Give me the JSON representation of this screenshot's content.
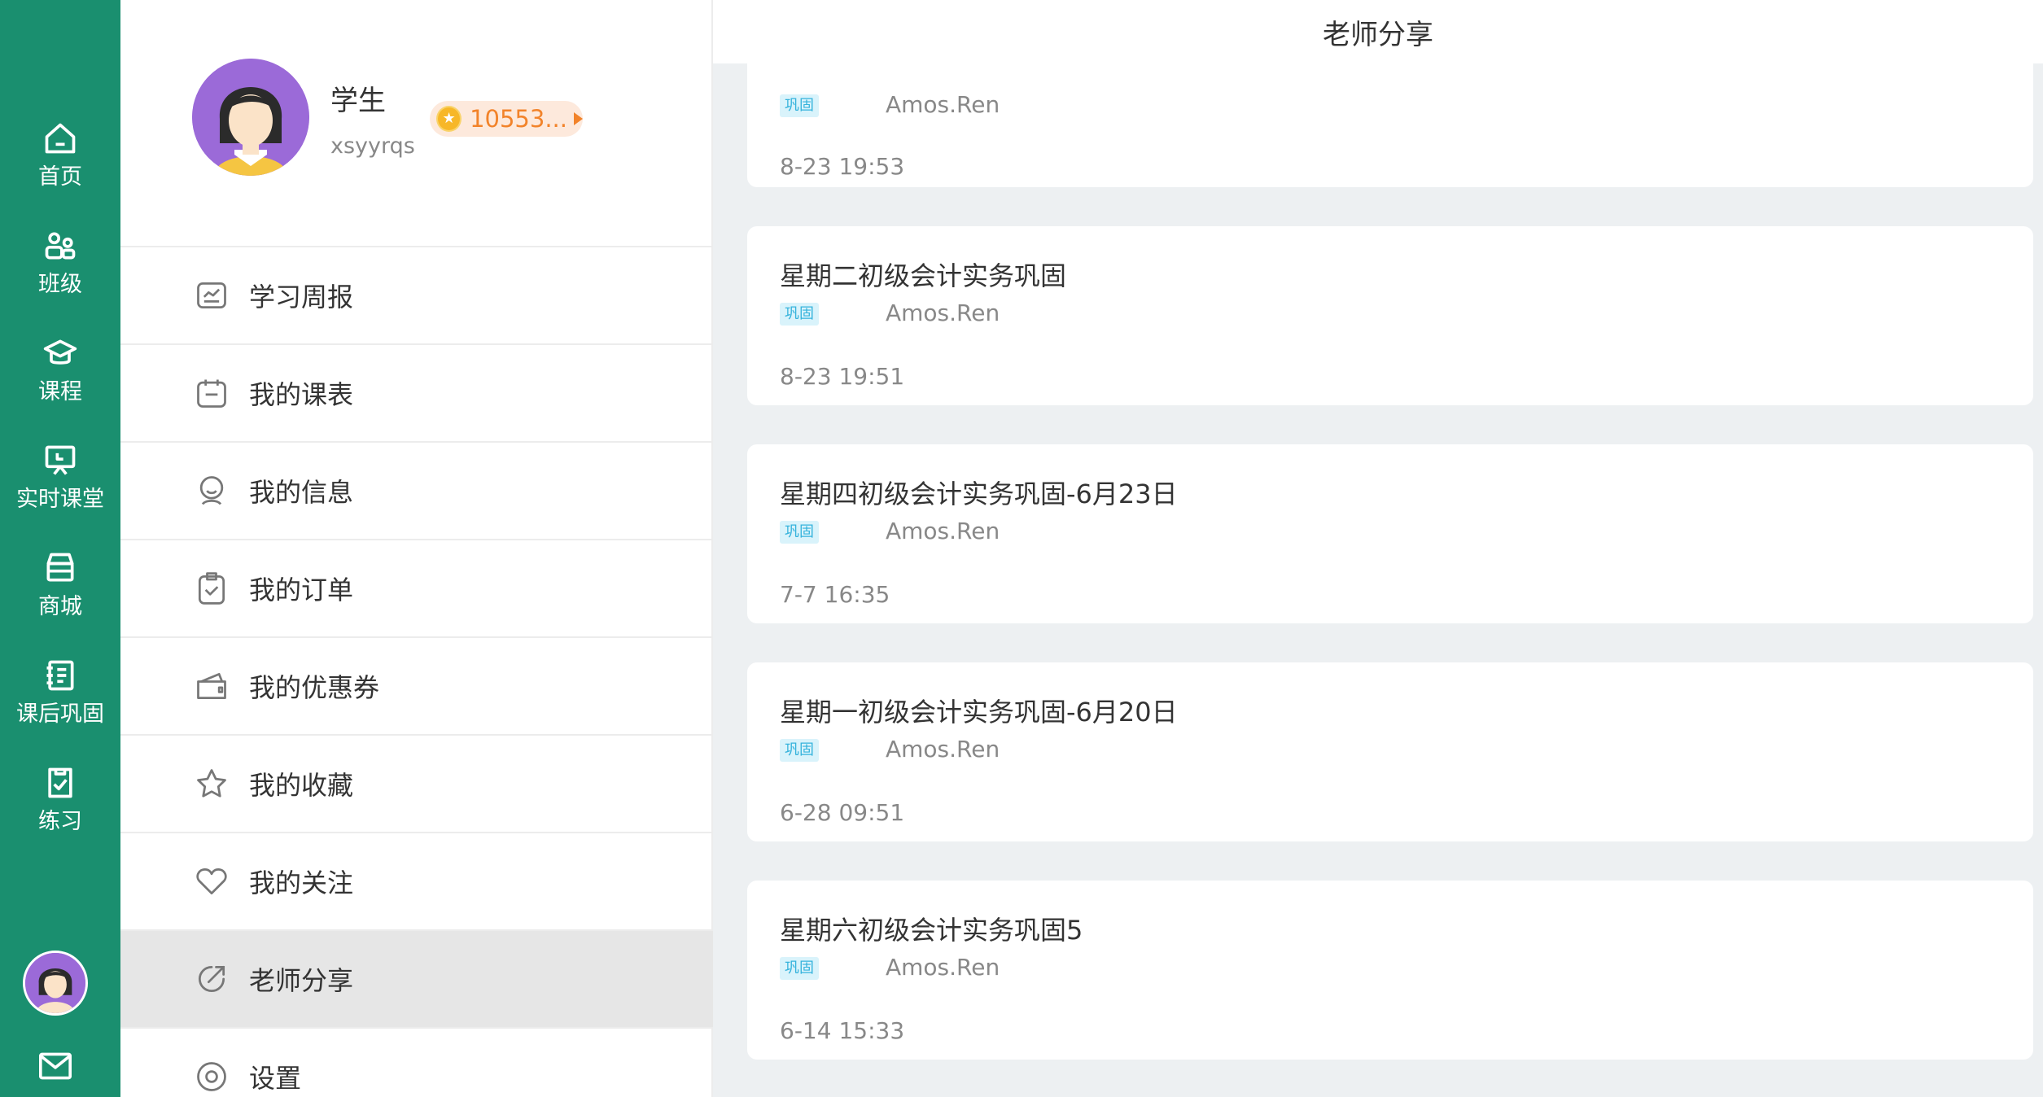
{
  "rail": {
    "items": [
      {
        "label": "首页",
        "icon": "home-icon"
      },
      {
        "label": "班级",
        "icon": "class-icon"
      },
      {
        "label": "课程",
        "icon": "graduation-cap-icon"
      },
      {
        "label": "实时课堂",
        "icon": "live-classroom-icon"
      },
      {
        "label": "商城",
        "icon": "store-icon"
      },
      {
        "label": "课后巩固",
        "icon": "homework-icon"
      },
      {
        "label": "练习",
        "icon": "practice-icon"
      }
    ],
    "bottom_icons": [
      "avatar",
      "mail-icon"
    ],
    "color": "#1a8f6f"
  },
  "profile": {
    "name": "学生",
    "user_id": "xsyyrqs",
    "points": "10553..."
  },
  "menu": {
    "items": [
      {
        "label": "学习周报",
        "icon": "weekly-report-icon"
      },
      {
        "label": "我的课表",
        "icon": "schedule-icon"
      },
      {
        "label": "我的信息",
        "icon": "profile-info-icon"
      },
      {
        "label": "我的订单",
        "icon": "order-icon"
      },
      {
        "label": "我的优惠券",
        "icon": "coupon-icon"
      },
      {
        "label": "我的收藏",
        "icon": "star-icon"
      },
      {
        "label": "我的关注",
        "icon": "heart-icon"
      },
      {
        "label": "老师分享",
        "icon": "share-icon",
        "active": true
      },
      {
        "label": "设置",
        "icon": "settings-icon"
      }
    ]
  },
  "content": {
    "title": "老师分享",
    "cards": [
      {
        "title": "",
        "tag": "巩固",
        "author": "Amos.Ren",
        "time": "8-23 19:53"
      },
      {
        "title": "星期二初级会计实务巩固",
        "tag": "巩固",
        "author": "Amos.Ren",
        "time": "8-23 19:51"
      },
      {
        "title": "星期四初级会计实务巩固-6月23日",
        "tag": "巩固",
        "author": "Amos.Ren",
        "time": "7-7 16:35"
      },
      {
        "title": "星期一初级会计实务巩固-6月20日",
        "tag": "巩固",
        "author": "Amos.Ren",
        "time": "6-28 09:51"
      },
      {
        "title": "星期六初级会计实务巩固5",
        "tag": "巩固",
        "author": "Amos.Ren",
        "time": "6-14 15:33"
      }
    ]
  },
  "colors": {
    "accent": "#1a8f6f",
    "points": "#f2832a",
    "tag_text": "#36b3dc",
    "tag_bg": "#d9f3fb",
    "active_menu_bg": "#e6e6e6",
    "content_bg": "#edf0f2"
  }
}
